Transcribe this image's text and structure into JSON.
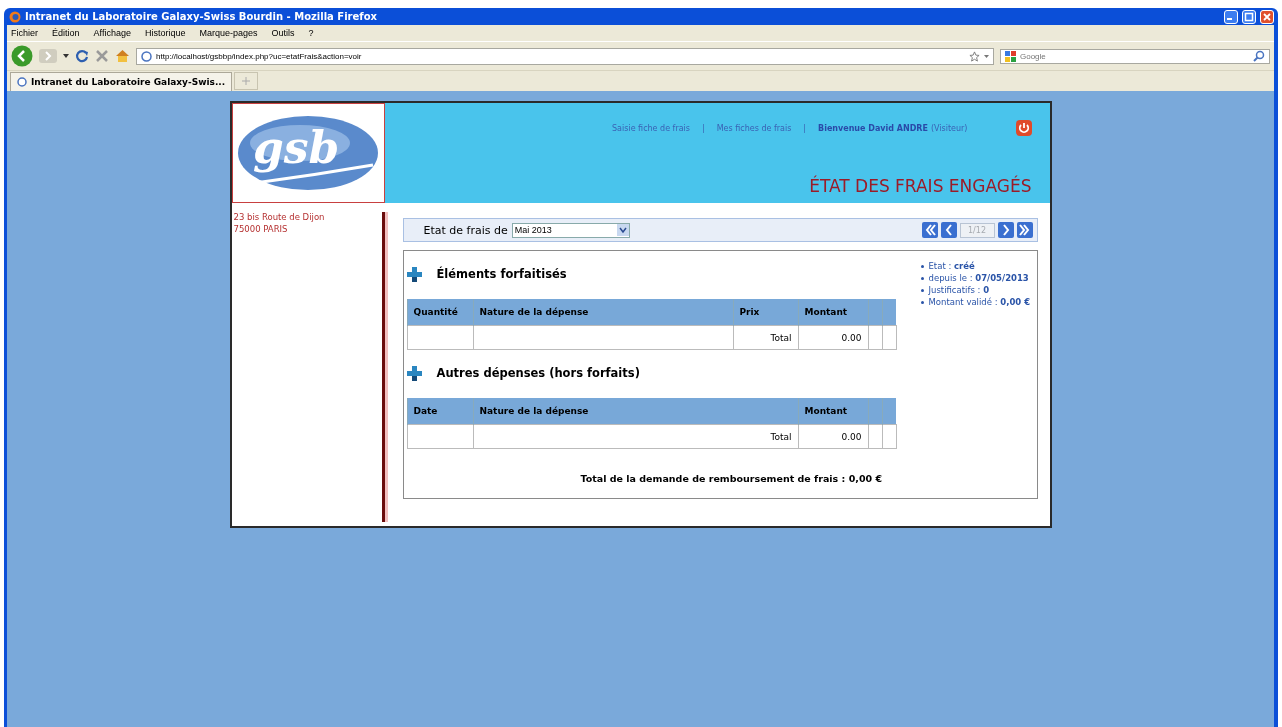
{
  "browser": {
    "title": "Intranet du Laboratoire Galaxy-Swiss Bourdin - Mozilla Firefox",
    "menu": [
      "Fichier",
      "Édition",
      "Affichage",
      "Historique",
      "Marque-pages",
      "Outils",
      "?"
    ],
    "url": "http://localhost/gsbbp/index.php?uc=etatFrais&action=voir",
    "search_placeholder": "Google",
    "tabs": [
      {
        "label": "Intranet du Laboratoire Galaxy-Swis...",
        "selected": true
      }
    ]
  },
  "header": {
    "nav": [
      {
        "kind": "link",
        "text": "Saisie fiche de frais"
      },
      {
        "kind": "separator",
        "text": "|"
      },
      {
        "kind": "link",
        "text": "Mes fiches de frais"
      },
      {
        "kind": "separator",
        "text": "|"
      },
      {
        "kind": "user",
        "text": "Bienvenue David ANDRE"
      },
      {
        "kind": "role",
        "text": "(Visiteur)"
      }
    ],
    "logo": "gsb",
    "title": "ÉTAT DES FRAIS ENGAGÉS"
  },
  "address": [
    "23 bis Route de Dijon",
    "75000 PARIS"
  ],
  "selector": {
    "label": "Etat de frais de",
    "value": "Mai 2013",
    "page": "1/12"
  },
  "sections": [
    {
      "title": "Éléments forfaitisés",
      "columns": [
        "Quantité",
        "Nature de la dépense",
        "Prix",
        "Montant"
      ],
      "total_label": "Total",
      "total": "0.00"
    },
    {
      "title": "Autres dépenses (hors forfaits)",
      "columns": [
        "Date",
        "Nature de la dépense",
        "Montant"
      ],
      "total_label": "Total",
      "total": "0.00"
    }
  ],
  "info": [
    "Etat : **créé**",
    "depuis le : **07/05/2013**",
    "Justificatifs : **0**",
    "Montant validé : **0,00 €**"
  ],
  "grand_total": "Total de la demande de remboursement de frais : 0,00 €"
}
